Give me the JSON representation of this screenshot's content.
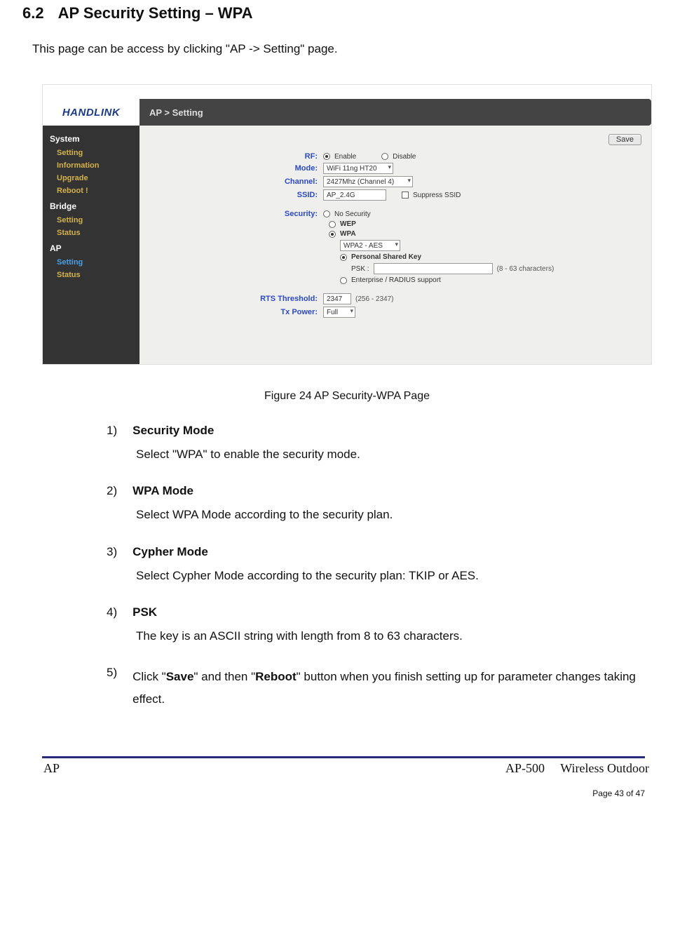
{
  "heading": {
    "num": "6.2",
    "title": "AP Security Setting – WPA"
  },
  "intro": "This page can be access by clicking \"AP -> Setting\" page.",
  "figure": {
    "logo": "HANDLINK",
    "breadcrumb": "AP > Setting",
    "save": "Save",
    "sidebar": {
      "groups": [
        {
          "label": "System",
          "items": [
            "Setting",
            "Information",
            "Upgrade",
            "Reboot !"
          ],
          "active": -1
        },
        {
          "label": "Bridge",
          "items": [
            "Setting",
            "Status"
          ],
          "active": -1
        },
        {
          "label": "AP",
          "items": [
            "Setting",
            "Status"
          ],
          "active": 0
        }
      ]
    },
    "form": {
      "rf_label": "RF:",
      "rf_enable": "Enable",
      "rf_disable": "Disable",
      "mode_label": "Mode:",
      "mode_value": "WiFi 11ng HT20",
      "channel_label": "Channel:",
      "channel_value": "2427Mhz (Channel 4)",
      "ssid_label": "SSID:",
      "ssid_value": "AP_2.4G",
      "suppress": "Suppress SSID",
      "security_label": "Security:",
      "sec_none": "No Security",
      "sec_wep": "WEP",
      "sec_wpa": "WPA",
      "wpa_mode_value": "WPA2 - AES",
      "psk_radio": "Personal Shared Key",
      "psk_label": "PSK :",
      "psk_hint": "(8 - 63 characters)",
      "enterprise": "Enterprise / RADIUS support",
      "rts_label": "RTS Threshold:",
      "rts_value": "2347",
      "rts_hint": "(256 - 2347)",
      "txp_label": "Tx Power:",
      "txp_value": "Full"
    }
  },
  "caption": "Figure 24    AP Security-WPA Page",
  "list": [
    {
      "n": "1)",
      "t": "Security Mode",
      "d": "Select \"WPA\" to enable the security mode."
    },
    {
      "n": "2)",
      "t": "WPA Mode",
      "d": "Select WPA Mode according to the security plan."
    },
    {
      "n": "3)",
      "t": "Cypher Mode",
      "d": "Select Cypher Mode according to the security plan: TKIP or AES."
    },
    {
      "n": "4)",
      "t": "PSK",
      "d": "The key is an ASCII string with length from 8 to 63 characters."
    }
  ],
  "item5": {
    "n": "5)",
    "pre": "Click \"",
    "b1": "Save",
    "mid": "\" and then \"",
    "b2": "Reboot",
    "post": "\" button when you finish setting up for parameter changes taking effect."
  },
  "footer": {
    "model": "AP-500",
    "desc": "Wireless  Outdoor",
    "ap": "AP",
    "page": "Page 43 of 47"
  }
}
